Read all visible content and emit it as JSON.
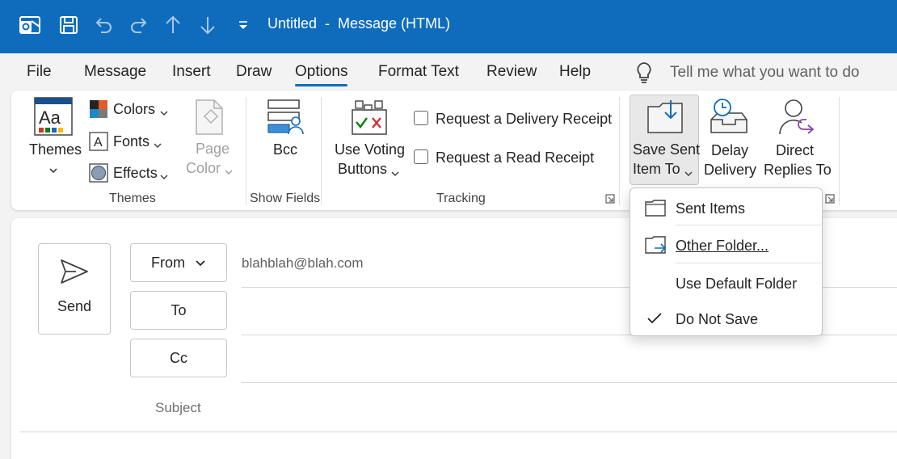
{
  "titlebar": {
    "title": "Untitled  -  Message (HTML)",
    "icons": [
      "outlook-icon",
      "save-icon",
      "undo-icon",
      "redo-icon",
      "up-arrow-icon",
      "down-arrow-icon",
      "customize-qat-icon"
    ],
    "accent": "#0f6cbd"
  },
  "menu": {
    "tabs": [
      "File",
      "Message",
      "Insert",
      "Draw",
      "Options",
      "Format Text",
      "Review",
      "Help"
    ],
    "active": "Options",
    "tell_me": "Tell me what you want to do"
  },
  "ribbon": {
    "themes": {
      "themes_label": "Themes",
      "colors_label": "Colors",
      "fonts_label": "Fonts",
      "effects_label": "Effects",
      "page_color_line1": "Page",
      "page_color_line2": "Color",
      "group_label": "Themes"
    },
    "show_fields": {
      "bcc_label": "Bcc",
      "group_label": "Show Fields"
    },
    "tracking": {
      "voting_line1": "Use Voting",
      "voting_line2": "Buttons",
      "delivery_receipt": "Request a Delivery Receipt",
      "read_receipt": "Request a Read Receipt",
      "group_label": "Tracking"
    },
    "more_options": {
      "save_sent_line1": "Save Sent",
      "save_sent_line2": "Item To",
      "delay_line1": "Delay",
      "delay_line2": "Delivery",
      "direct_line1": "Direct",
      "direct_line2": "Replies To"
    }
  },
  "compose": {
    "send_label": "Send",
    "from_label": "From",
    "from_value": "blahblah@blah.com",
    "to_label": "To",
    "cc_label": "Cc",
    "subject_label": "Subject"
  },
  "dropdown": {
    "items": [
      {
        "label": "Sent Items",
        "icon": "folder-icon",
        "checked": false
      },
      {
        "label": "Other Folder...",
        "icon": "folder-move-icon",
        "checked": false
      },
      {
        "label": "Use Default Folder",
        "icon": "",
        "checked": false
      },
      {
        "label": "Do Not Save",
        "icon": "checkmark-icon",
        "checked": true
      }
    ]
  }
}
